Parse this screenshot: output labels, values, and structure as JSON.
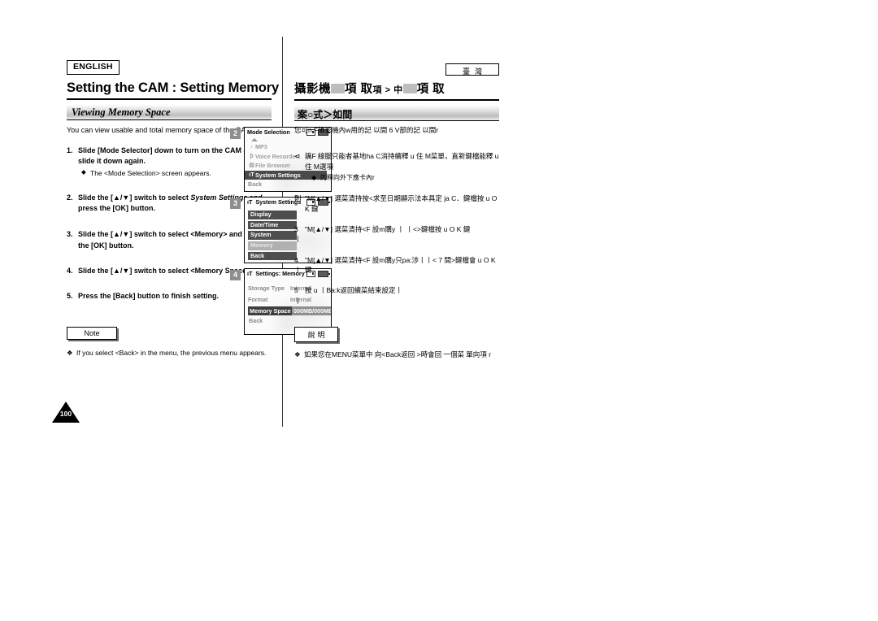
{
  "left": {
    "language_badge": "ENGLISH",
    "title": "Setting the CAM : Setting Memory",
    "subhead": "Viewing Memory Space",
    "intro": "You can view usable and total memory space of the CAM.",
    "steps": [
      {
        "num": "1.",
        "text_before": "Slide [Mode Selector] down to turn on the CAM and slide it down again.",
        "italic": "",
        "text_after": "",
        "bullet": "The <Mode Selection> screen appears."
      },
      {
        "num": "2.",
        "text_before": "Slide the [▲/▼] switch to select ",
        "italic": "System Settings",
        "text_after": " and press the [OK] button.",
        "bullet": ""
      },
      {
        "num": "3.",
        "text_before": "Slide the [▲/▼] switch to select <Memory> and press the [OK] button.",
        "italic": "",
        "text_after": "",
        "bullet": ""
      },
      {
        "num": "4.",
        "text_before": "Slide the [▲/▼] switch to select <Memory Space>.",
        "italic": "",
        "text_after": "",
        "bullet": ""
      },
      {
        "num": "5.",
        "text_before": "Press the [Back] button to finish setting.",
        "italic": "",
        "text_after": "",
        "bullet": ""
      }
    ],
    "note_tab": "Note",
    "note_mark": "❖",
    "note_text": "If you select <Back> in the menu, the previous menu appears.",
    "page_number": "100"
  },
  "lcd_screens": [
    {
      "badge": "2",
      "title": "Mode Selection",
      "title_icon": "",
      "type": "mode-selection",
      "items": [
        {
          "label": "MP3",
          "icon": "♪",
          "state": "dim"
        },
        {
          "label": "Voice Recorder",
          "icon": "ƥ",
          "state": "dim"
        },
        {
          "label": "File Browser",
          "icon": "▤",
          "state": "dim"
        },
        {
          "label": "System Settings",
          "icon": "ıT",
          "state": "selected"
        },
        {
          "label": "Back",
          "icon": "",
          "state": "plain"
        }
      ]
    },
    {
      "badge": "3",
      "title": "System Settings",
      "title_icon": "ıT",
      "type": "system-settings",
      "items": [
        {
          "label": "Display",
          "state": "normal"
        },
        {
          "label": "Date/Time",
          "state": "normal"
        },
        {
          "label": "System",
          "state": "normal"
        },
        {
          "label": "Memory",
          "state": "highlight"
        },
        {
          "label": "Back",
          "state": "normal"
        }
      ]
    },
    {
      "badge": "4",
      "title": "Settings: Memory",
      "title_icon": "ıT",
      "type": "settings-memory",
      "rows": [
        {
          "label": "Storage Type",
          "value": "Internal",
          "state": "normal"
        },
        {
          "label": "Format",
          "value": "Internal",
          "state": "normal"
        },
        {
          "label": "Memory Space",
          "value": "000MB/000MB",
          "state": "selected"
        }
      ],
      "back_label": "Back"
    }
  ],
  "right": {
    "region_badge": "臺灣",
    "title_part1": "攝影機",
    "title_part2": "項 取",
    "title_part3": "項 > 中",
    "title_part4": "項 取",
    "subhead": "案○式＞如間",
    "intro": "您可n F攝影機內w用的記 以間 6 V部的記 以間r",
    "steps": [
      {
        "num": "⊲",
        "text": "簼F 線腦只能者基地ha C消持續釋 u 住 M菜單，直新鍵檔能釋 u 住 M選項",
        "bullet": "的釋向外下應卡內r"
      },
      {
        "num": "則",
        "text": "\"M[▲/▼] 選菜清持按<求至日期顯示法本具定 ja C．鍵檔按 u O K 鍵",
        "bullet": ""
      },
      {
        "num": "3丨",
        "text": "\"M[▲/▼] 選菜清持<F 設m購y 丨 丨<>鍵檔按 u O K 鍵",
        "bullet": ""
      },
      {
        "num": "4丨",
        "text": "\"M[▲/▼] 選菜清持<F 設m購y只pa:涉丨丨< 7 間>鍵檔會 u O K 鍵",
        "bullet": ""
      },
      {
        "num": "5丨",
        "text": "按 u 丨Ba:k返回續菜結束設定丨",
        "bullet": ""
      }
    ],
    "note_tab": "說明",
    "note_mark": "❖",
    "note_text": "如果您在MENU菜單中 向<Back返回 >時會回 一個菜 單向項 r"
  },
  "colors": {
    "page_bg": "#ffffff",
    "text": "#000000",
    "rule": "#000000",
    "subhead_gradient_mid": "#bdbdbd",
    "lcd_selected_bg": "#4a4a4a",
    "lcd_item_bg": "#4e4e4e",
    "lcd_highlight_bg": "#b0b0b0",
    "badge_bg": "#8e8e8e",
    "dim_text": "#9d9d9d"
  }
}
